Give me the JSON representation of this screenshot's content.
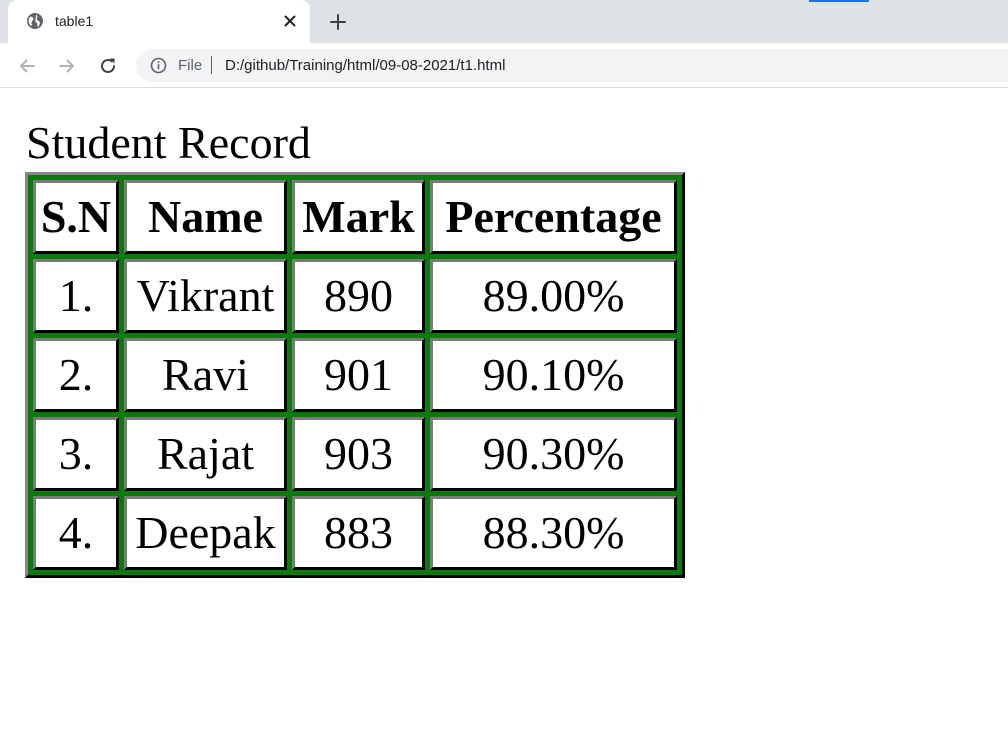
{
  "browser": {
    "tab": {
      "title": "table1"
    },
    "toolbar": {
      "scheme_label": "File",
      "url": "D:/github/Training/html/09-08-2021/t1.html"
    }
  },
  "page": {
    "heading": "Student Record",
    "table": {
      "headers": [
        "S.N",
        "Name",
        "Mark",
        "Percentage"
      ],
      "rows": [
        [
          "1.",
          "Vikrant",
          "890",
          "89.00%"
        ],
        [
          "2.",
          "Ravi",
          "901",
          "90.10%"
        ],
        [
          "3.",
          "Rajat",
          "903",
          "90.30%"
        ],
        [
          "4.",
          "Deepak",
          "883",
          "88.30%"
        ]
      ],
      "background_color": "#0a7a0a"
    }
  },
  "icons": {
    "tab_favicon": "globe-icon",
    "tab_close": "close-icon",
    "new_tab": "plus-icon",
    "back": "arrow-left-icon",
    "forward": "arrow-right-icon",
    "reload": "reload-icon",
    "site_info": "info-icon"
  }
}
